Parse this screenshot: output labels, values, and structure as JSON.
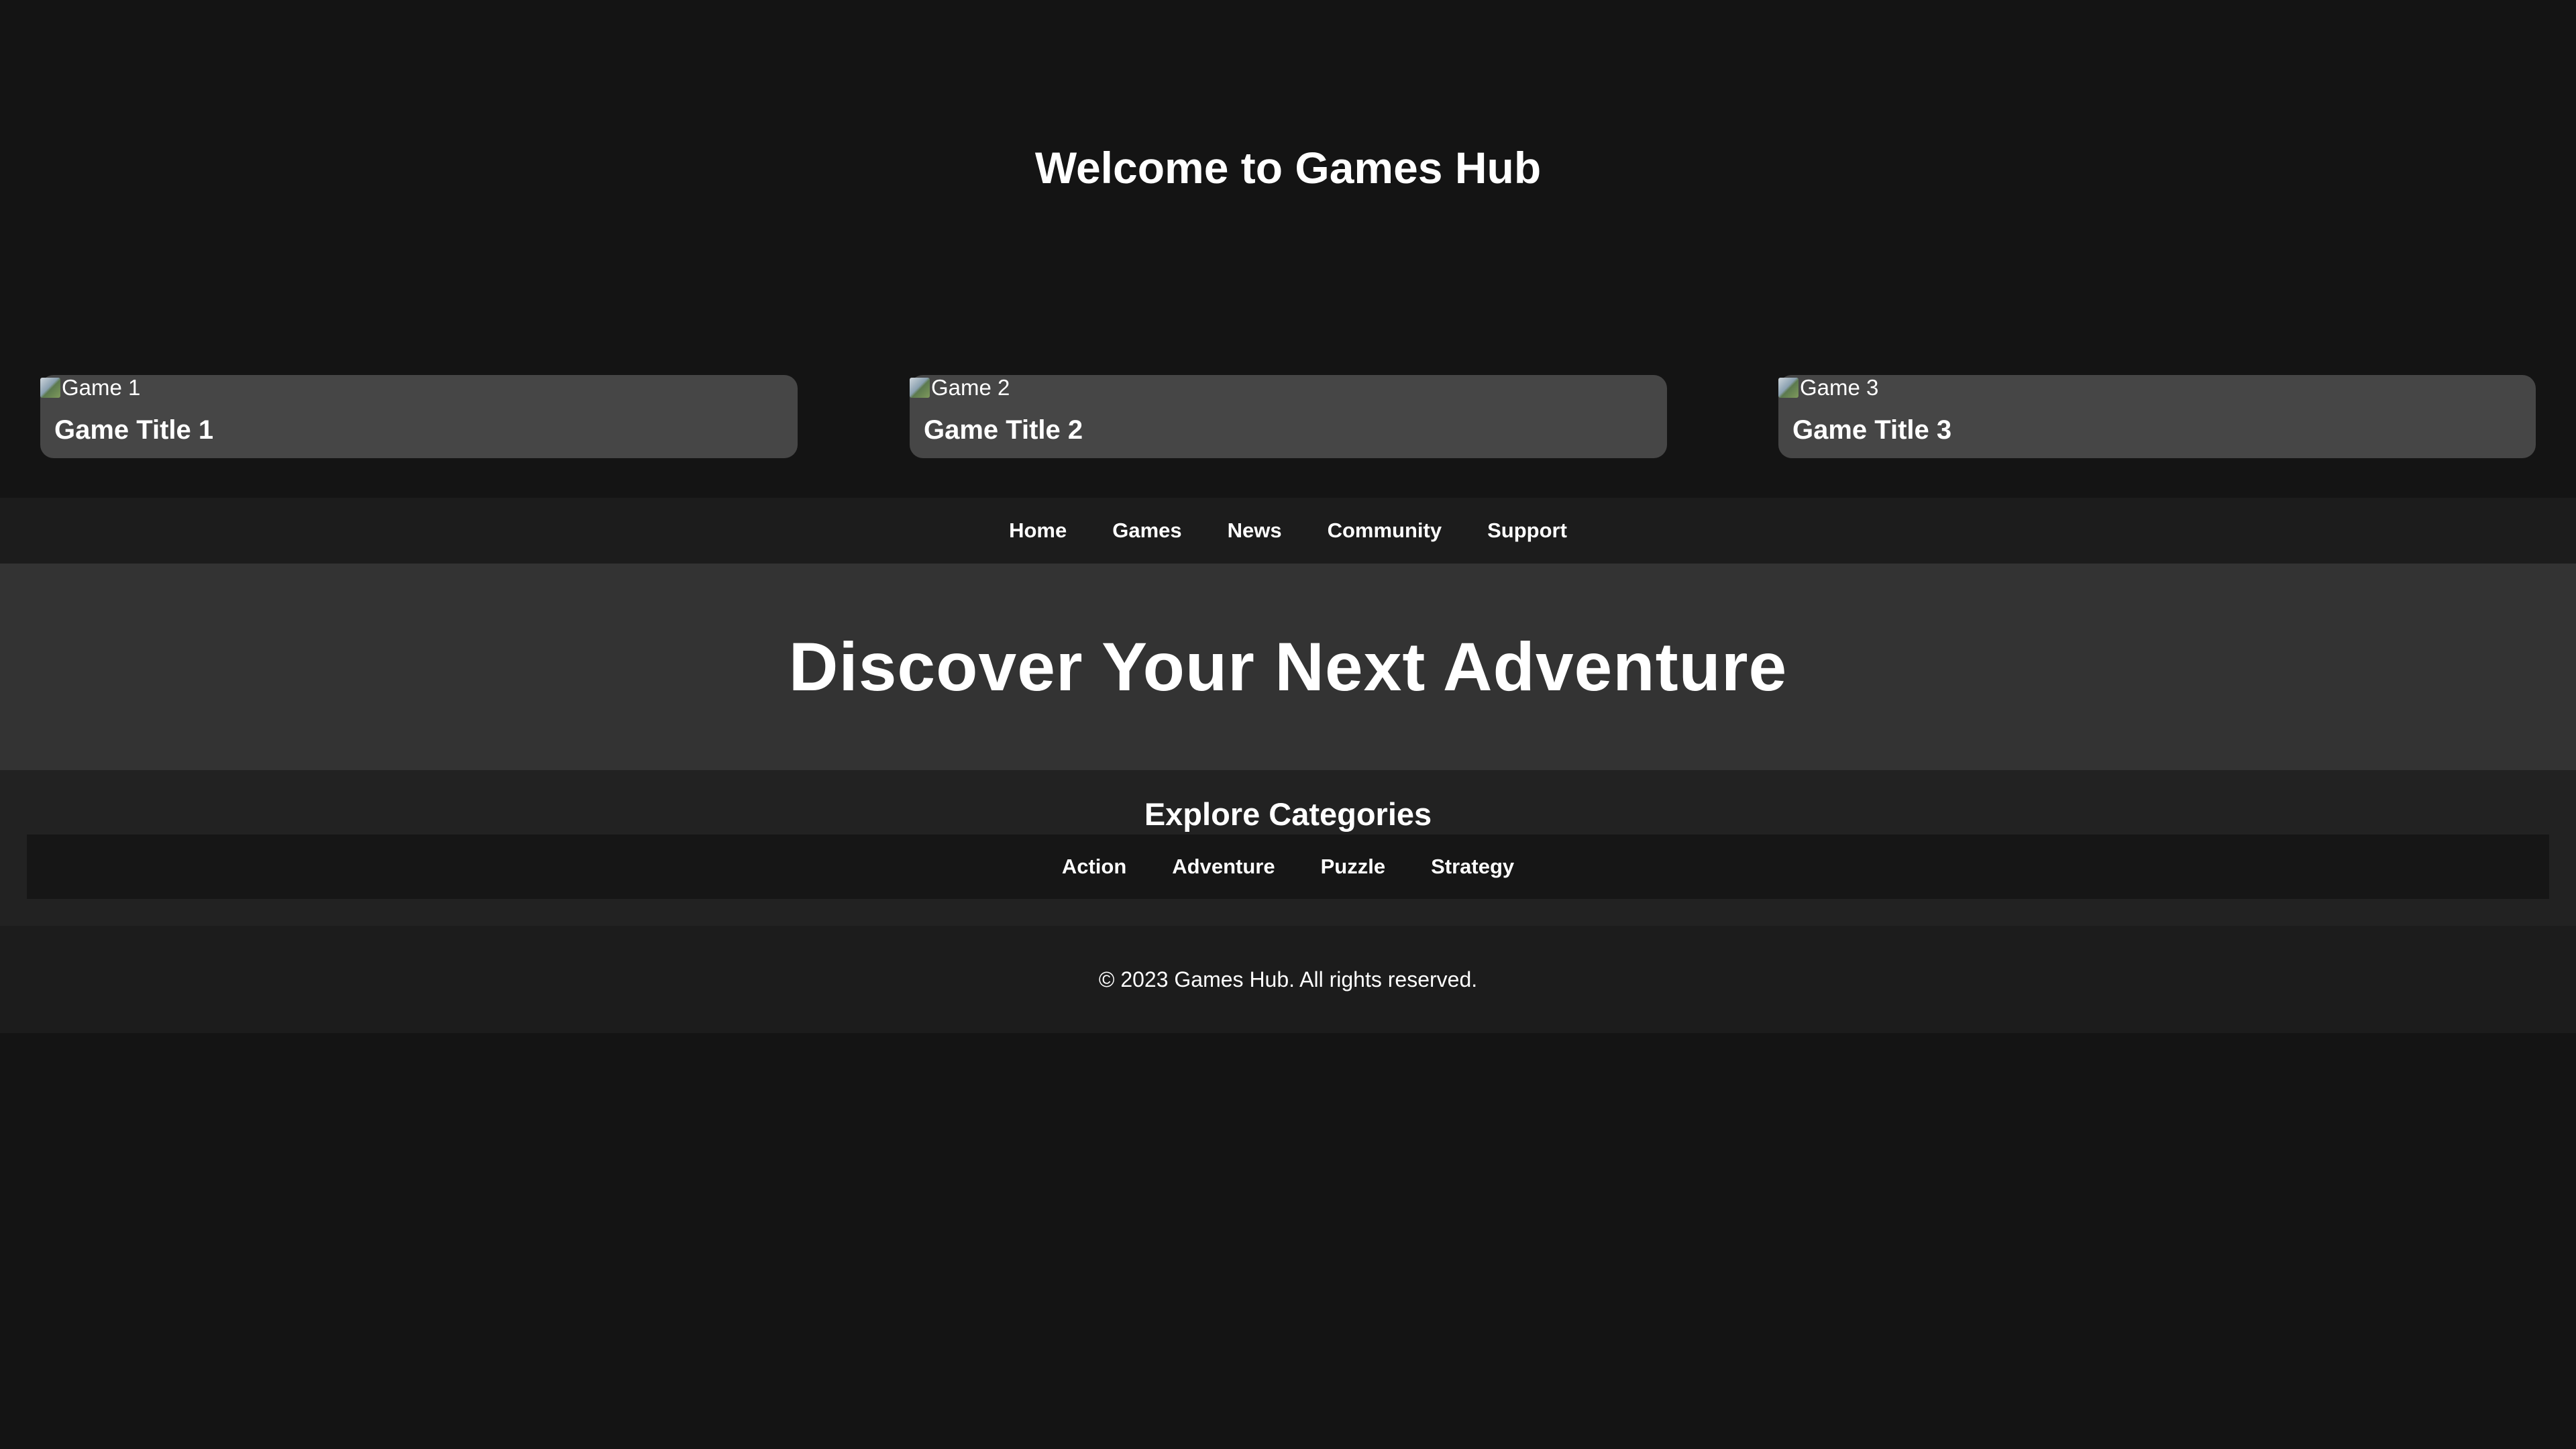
{
  "header": {
    "title": "Welcome to Games Hub"
  },
  "games": [
    {
      "image_alt": "Game 1",
      "title": "Game Title 1"
    },
    {
      "image_alt": "Game 2",
      "title": "Game Title 2"
    },
    {
      "image_alt": "Game 3",
      "title": "Game Title 3"
    }
  ],
  "nav": {
    "items": [
      "Home",
      "Games",
      "News",
      "Community",
      "Support"
    ]
  },
  "hero": {
    "title": "Discover Your Next Adventure"
  },
  "categories": {
    "heading": "Explore Categories",
    "items": [
      "Action",
      "Adventure",
      "Puzzle",
      "Strategy"
    ]
  },
  "footer": {
    "text": "© 2023 Games Hub. All rights reserved."
  },
  "colors": {
    "page_background": "#141414",
    "card_background": "#464646",
    "nav_background": "#1c1c1c",
    "hero_background": "#333333",
    "categories_background": "#222222",
    "category_bar_background": "#161616",
    "text": "#ffffff"
  }
}
